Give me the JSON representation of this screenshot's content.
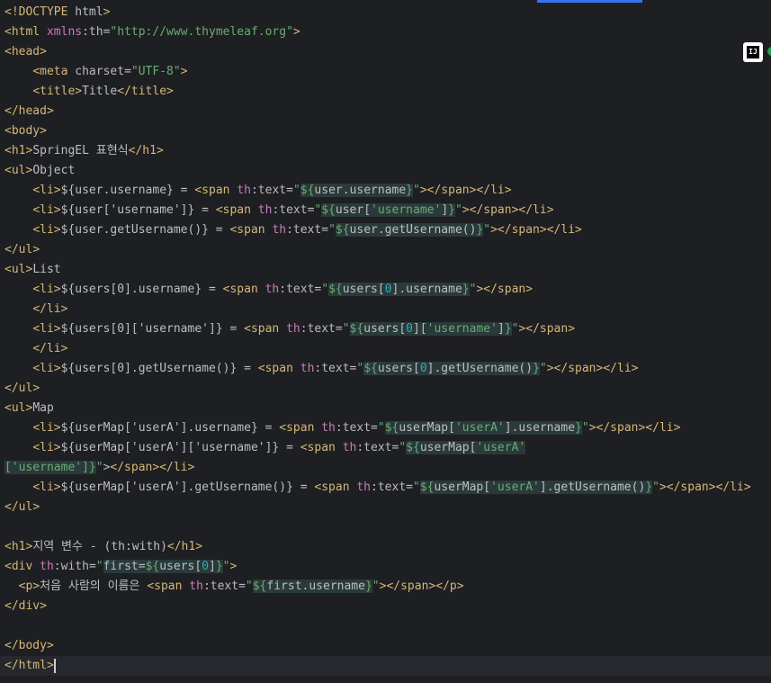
{
  "editor": {
    "lines": [
      "<!DOCTYPE html>",
      "<html xmlns:th=\"http://www.thymeleaf.org\">",
      "<head>",
      "    <meta charset=\"UTF-8\">",
      "    <title>Title</title>",
      "</head>",
      "<body>",
      "<h1>SpringEL 표현식</h1>",
      "<ul>Object",
      "    <li>${user.username} = <span th:text=\"${user.username}\"></span></li>",
      "    <li>${user['username']} = <span th:text=\"${user['username']}\"></span></li>",
      "    <li>${user.getUsername()} = <span th:text=\"${user.getUsername()}\"></span></li>",
      "</ul>",
      "<ul>List",
      "    <li>${users[0].username} = <span th:text=\"${users[0].username}\"></span>",
      "    </li>",
      "    <li>${users[0]['username']} = <span th:text=\"${users[0]['username']}\"></span>",
      "    </li>",
      "    <li>${users[0].getUsername()} = <span th:text=\"${users[0].getUsername()}\"></span></li>",
      "</ul>",
      "<ul>Map",
      "    <li>${userMap['userA'].username} = <span th:text=\"${userMap['userA'].username}\"></span></li>",
      "    <li>${userMap['userA']['username']} = <span th:text=\"${userMap['userA']",
      "['username']}\"></span></li>",
      "    <li>${userMap['userA'].getUsername()} = <span th:text=\"${userMap['userA'].getUsername()}\"></span></li>",
      "</ul>",
      "",
      "<h1>지역 변수 - (th:with)</h1>",
      "<div th:with=\"first=${users[0]}\">",
      "  <p>처음 사람의 이름은 <span th:text=\"${first.username}\"></span></p>",
      "</div>",
      "",
      "</body>",
      "</html>"
    ],
    "current_line": 34,
    "icons": {
      "ide_badge": "intellij-icon",
      "browser": "chrome-icon"
    },
    "colors": {
      "background": "#1e1f22",
      "tag": "#d5b778",
      "attribute_namespace": "#c77dbb",
      "string": "#6aab73",
      "number": "#2aacb8",
      "accent": "#3574f0"
    }
  }
}
